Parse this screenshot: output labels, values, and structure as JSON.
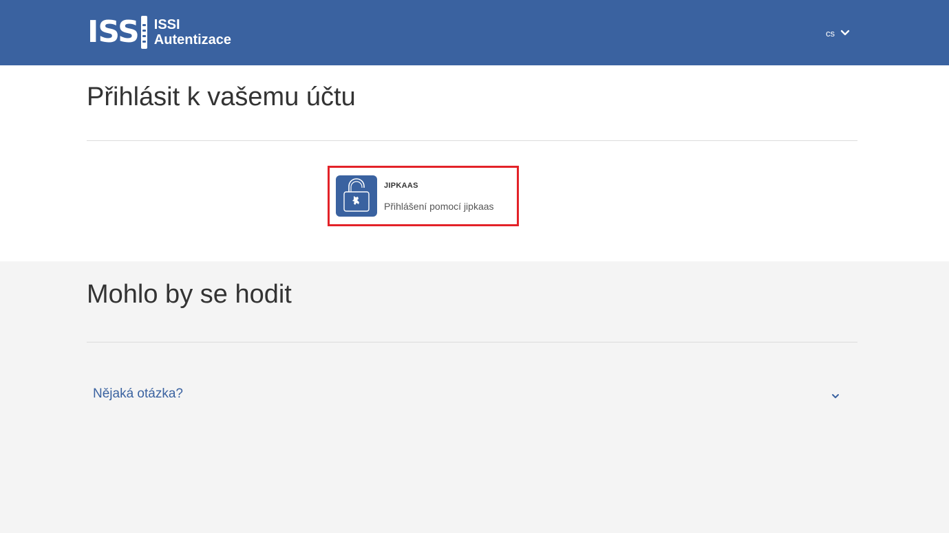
{
  "header": {
    "logo_letters": "ISS",
    "logo_line1": "ISSI",
    "logo_line2": "Autentizace",
    "language": "cs"
  },
  "main": {
    "title": "Přihlásit k vašemu účtu",
    "idp": {
      "name": "JIPKAAS",
      "description": "Přihlášení pomocí jipkaas",
      "icon": "padlock-lion-icon"
    }
  },
  "help": {
    "title": "Mohlo by se hodit",
    "faq_item": "Nějaká otázka?"
  },
  "colors": {
    "brand": "#3a62a0",
    "highlight": "#e32228"
  }
}
